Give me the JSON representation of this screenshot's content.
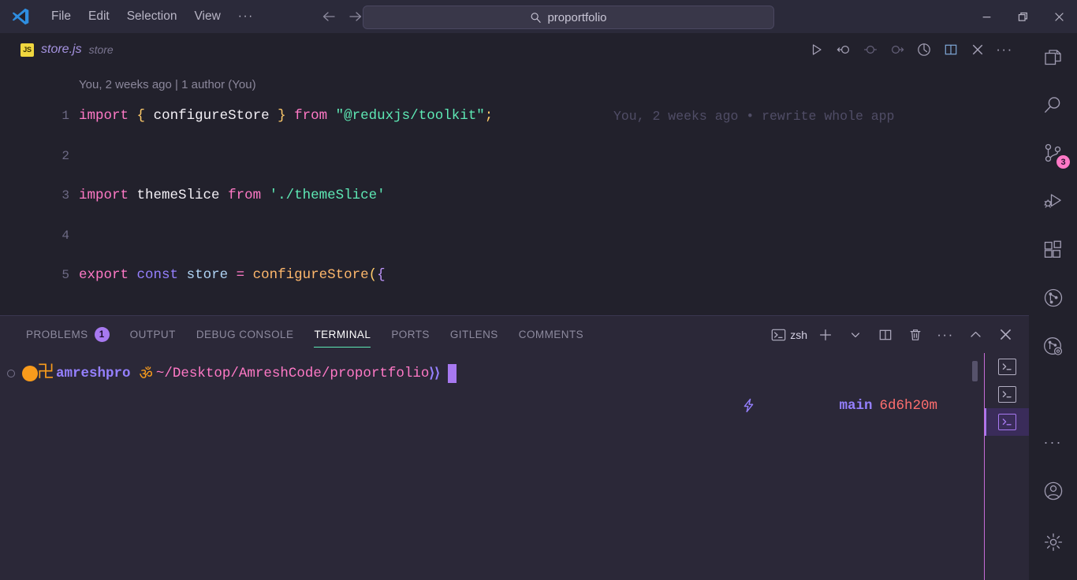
{
  "window": {
    "titlebar": {
      "logo_icon": "vscode-logo-icon",
      "menus": [
        "File",
        "Edit",
        "Selection",
        "View"
      ],
      "overflow_label": "···",
      "nav_back_icon": "arrow-left-icon",
      "nav_forward_icon": "arrow-right-icon",
      "search": {
        "icon": "search-icon",
        "value": "proportfolio",
        "placeholder": "Search"
      },
      "controls": {
        "minimize_icon": "minimize-icon",
        "restore_icon": "restore-icon",
        "close_icon": "close-icon"
      }
    }
  },
  "activitybar": {
    "items": [
      {
        "name": "explorer",
        "icon": "files-icon",
        "badge": null
      },
      {
        "name": "search",
        "icon": "search-icon",
        "badge": null
      },
      {
        "name": "source-control",
        "icon": "source-control-icon",
        "badge": "3"
      },
      {
        "name": "run-and-debug",
        "icon": "debug-play-icon",
        "badge": null
      },
      {
        "name": "extensions",
        "icon": "extensions-icon",
        "badge": null
      },
      {
        "name": "gitlens",
        "icon": "gitlens-icon",
        "badge": null
      },
      {
        "name": "gitlens-inspect",
        "icon": "gitlens-inspect-icon",
        "badge": null
      }
    ],
    "bottom_items": [
      {
        "name": "more-actions",
        "icon": "ellipsis-icon",
        "label": "···"
      },
      {
        "name": "accounts",
        "icon": "account-icon"
      },
      {
        "name": "settings",
        "icon": "gear-icon"
      }
    ],
    "badge_color": "#ff79c6"
  },
  "editor": {
    "tab": {
      "filetype_badge": "JS",
      "filename": "store.js",
      "description": "store"
    },
    "actions": [
      {
        "name": "run-code",
        "icon": "play-icon"
      },
      {
        "name": "step-back",
        "icon": "step-back-icon"
      },
      {
        "name": "toggle-breakpoint",
        "icon": "circle-icon"
      },
      {
        "name": "step-forward",
        "icon": "step-forward-icon"
      },
      {
        "name": "open-changes",
        "icon": "file-history-icon"
      },
      {
        "name": "split-editor",
        "icon": "split-editor-icon"
      },
      {
        "name": "close-editor",
        "icon": "close-icon"
      },
      {
        "name": "more-editor-actions",
        "icon": "ellipsis-icon",
        "label": "···"
      }
    ],
    "blame_header": "You, 2 weeks ago | 1 author (You)",
    "inline_blame": "You, 2 weeks ago • rewrite whole app",
    "lines": [
      {
        "number": "1",
        "tokens": [
          {
            "t": "import",
            "c": "t-kw"
          },
          {
            "t": " ",
            "c": "t-id"
          },
          {
            "t": "{",
            "c": "t-punc"
          },
          {
            "t": " ",
            "c": "t-id"
          },
          {
            "t": "configureStore",
            "c": "t-id"
          },
          {
            "t": " ",
            "c": "t-id"
          },
          {
            "t": "}",
            "c": "t-punc"
          },
          {
            "t": " ",
            "c": "t-id"
          },
          {
            "t": "from",
            "c": "t-kw"
          },
          {
            "t": " ",
            "c": "t-id"
          },
          {
            "t": "\"@reduxjs/toolkit\"",
            "c": "t-str"
          },
          {
            "t": ";",
            "c": "t-punc"
          }
        ]
      },
      {
        "number": "2",
        "tokens": []
      },
      {
        "number": "3",
        "tokens": [
          {
            "t": "import",
            "c": "t-kw"
          },
          {
            "t": " ",
            "c": "t-id"
          },
          {
            "t": "themeSlice",
            "c": "t-id"
          },
          {
            "t": " ",
            "c": "t-id"
          },
          {
            "t": "from",
            "c": "t-kw"
          },
          {
            "t": " ",
            "c": "t-id"
          },
          {
            "t": "'./themeSlice'",
            "c": "t-str"
          }
        ]
      },
      {
        "number": "4",
        "tokens": []
      },
      {
        "number": "5",
        "tokens": [
          {
            "t": "export",
            "c": "t-kw"
          },
          {
            "t": " ",
            "c": "t-id"
          },
          {
            "t": "const",
            "c": "t-const"
          },
          {
            "t": " ",
            "c": "t-id"
          },
          {
            "t": "store",
            "c": "t-var"
          },
          {
            "t": " ",
            "c": "t-id"
          },
          {
            "t": "=",
            "c": "t-op"
          },
          {
            "t": " ",
            "c": "t-id"
          },
          {
            "t": "configureStore",
            "c": "t-fn"
          },
          {
            "t": "(",
            "c": "t-punc"
          },
          {
            "t": "{",
            "c": "t-brace"
          }
        ]
      }
    ]
  },
  "panel": {
    "tabs": [
      {
        "label": "PROBLEMS",
        "badge": "1",
        "active": false
      },
      {
        "label": "OUTPUT",
        "badge": null,
        "active": false
      },
      {
        "label": "DEBUG CONSOLE",
        "badge": null,
        "active": false
      },
      {
        "label": "TERMINAL",
        "badge": null,
        "active": true
      },
      {
        "label": "PORTS",
        "badge": null,
        "active": false
      },
      {
        "label": "GITLENS",
        "badge": null,
        "active": false
      },
      {
        "label": "COMMENTS",
        "badge": null,
        "active": false
      }
    ],
    "active_underline_color": "#5ee9b5",
    "problems_badge_color": "#a779f0",
    "actions": {
      "shell_icon": "terminal-icon",
      "shell_label": "zsh",
      "new_terminal_icon": "plus-icon",
      "new_terminal_dropdown_icon": "chevron-down-icon",
      "split_terminal_icon": "split-icon",
      "kill_terminal_icon": "trash-icon",
      "more_actions_icon": "ellipsis-icon",
      "more_actions_label": "···",
      "maximize_panel_icon": "chevron-up-icon",
      "close_panel_icon": "close-icon"
    }
  },
  "terminal": {
    "prompt": {
      "decoration_icon": "command-decoration-icon",
      "orb_icon": "orange-orb-icon",
      "swastika_glyph": "卍",
      "user": "amreshpro",
      "om_glyph": "ॐ",
      "path": "~/Desktop/AmreshCode/proportfolio",
      "arrow": "⟩⟩",
      "cursor": "block-cursor"
    },
    "right_status": {
      "bolt_glyph": "⚡",
      "branch": "main",
      "duration": "6d6h20m"
    },
    "tabs": [
      {
        "name": "terminal-tab-1",
        "icon": "terminal-icon",
        "active": false
      },
      {
        "name": "terminal-tab-2",
        "icon": "terminal-icon",
        "active": false
      },
      {
        "name": "terminal-tab-3",
        "icon": "terminal-icon",
        "active": true
      }
    ]
  }
}
